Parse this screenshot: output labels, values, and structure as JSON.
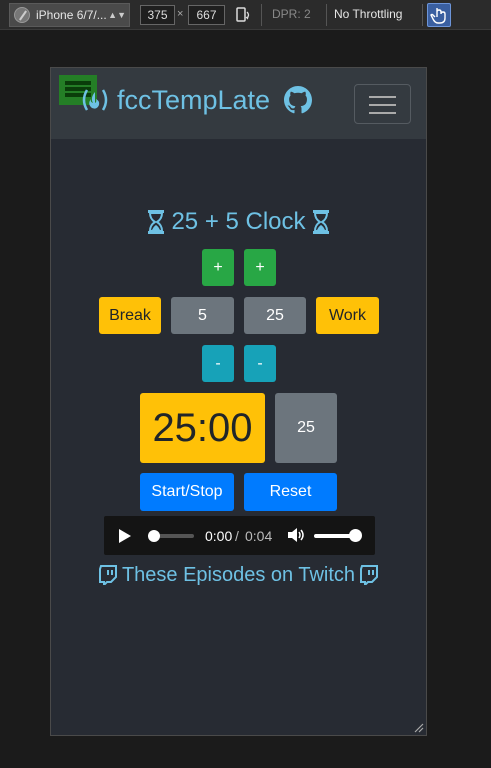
{
  "devtools": {
    "device": "iPhone 6/7/...",
    "width": "375",
    "times": "×",
    "height": "667",
    "dpr": "DPR: 2",
    "throttling": "No Throttling"
  },
  "navbar": {
    "brand": "fccTempLate"
  },
  "clock": {
    "title": "25 + 5 Clock",
    "break_plus": "+",
    "session_plus": "+",
    "break_label": "Break",
    "break_length": "5",
    "session_length": "25",
    "session_label": "Work",
    "break_minus": "-",
    "session_minus": "-",
    "timer": "25:00",
    "timer_secondary": "25",
    "start_stop": "Start/Stop",
    "reset": "Reset"
  },
  "audio": {
    "current_time": "0:00",
    "separator": "/",
    "duration": "0:04"
  },
  "footer": {
    "twitch_text": "These Episodes on Twitch"
  },
  "colors": {
    "accent": "#6ec1e4",
    "green": "#28a745",
    "teal": "#17a2b8",
    "yellow": "#ffc107",
    "gray": "#6c757d",
    "blue": "#007bff"
  }
}
